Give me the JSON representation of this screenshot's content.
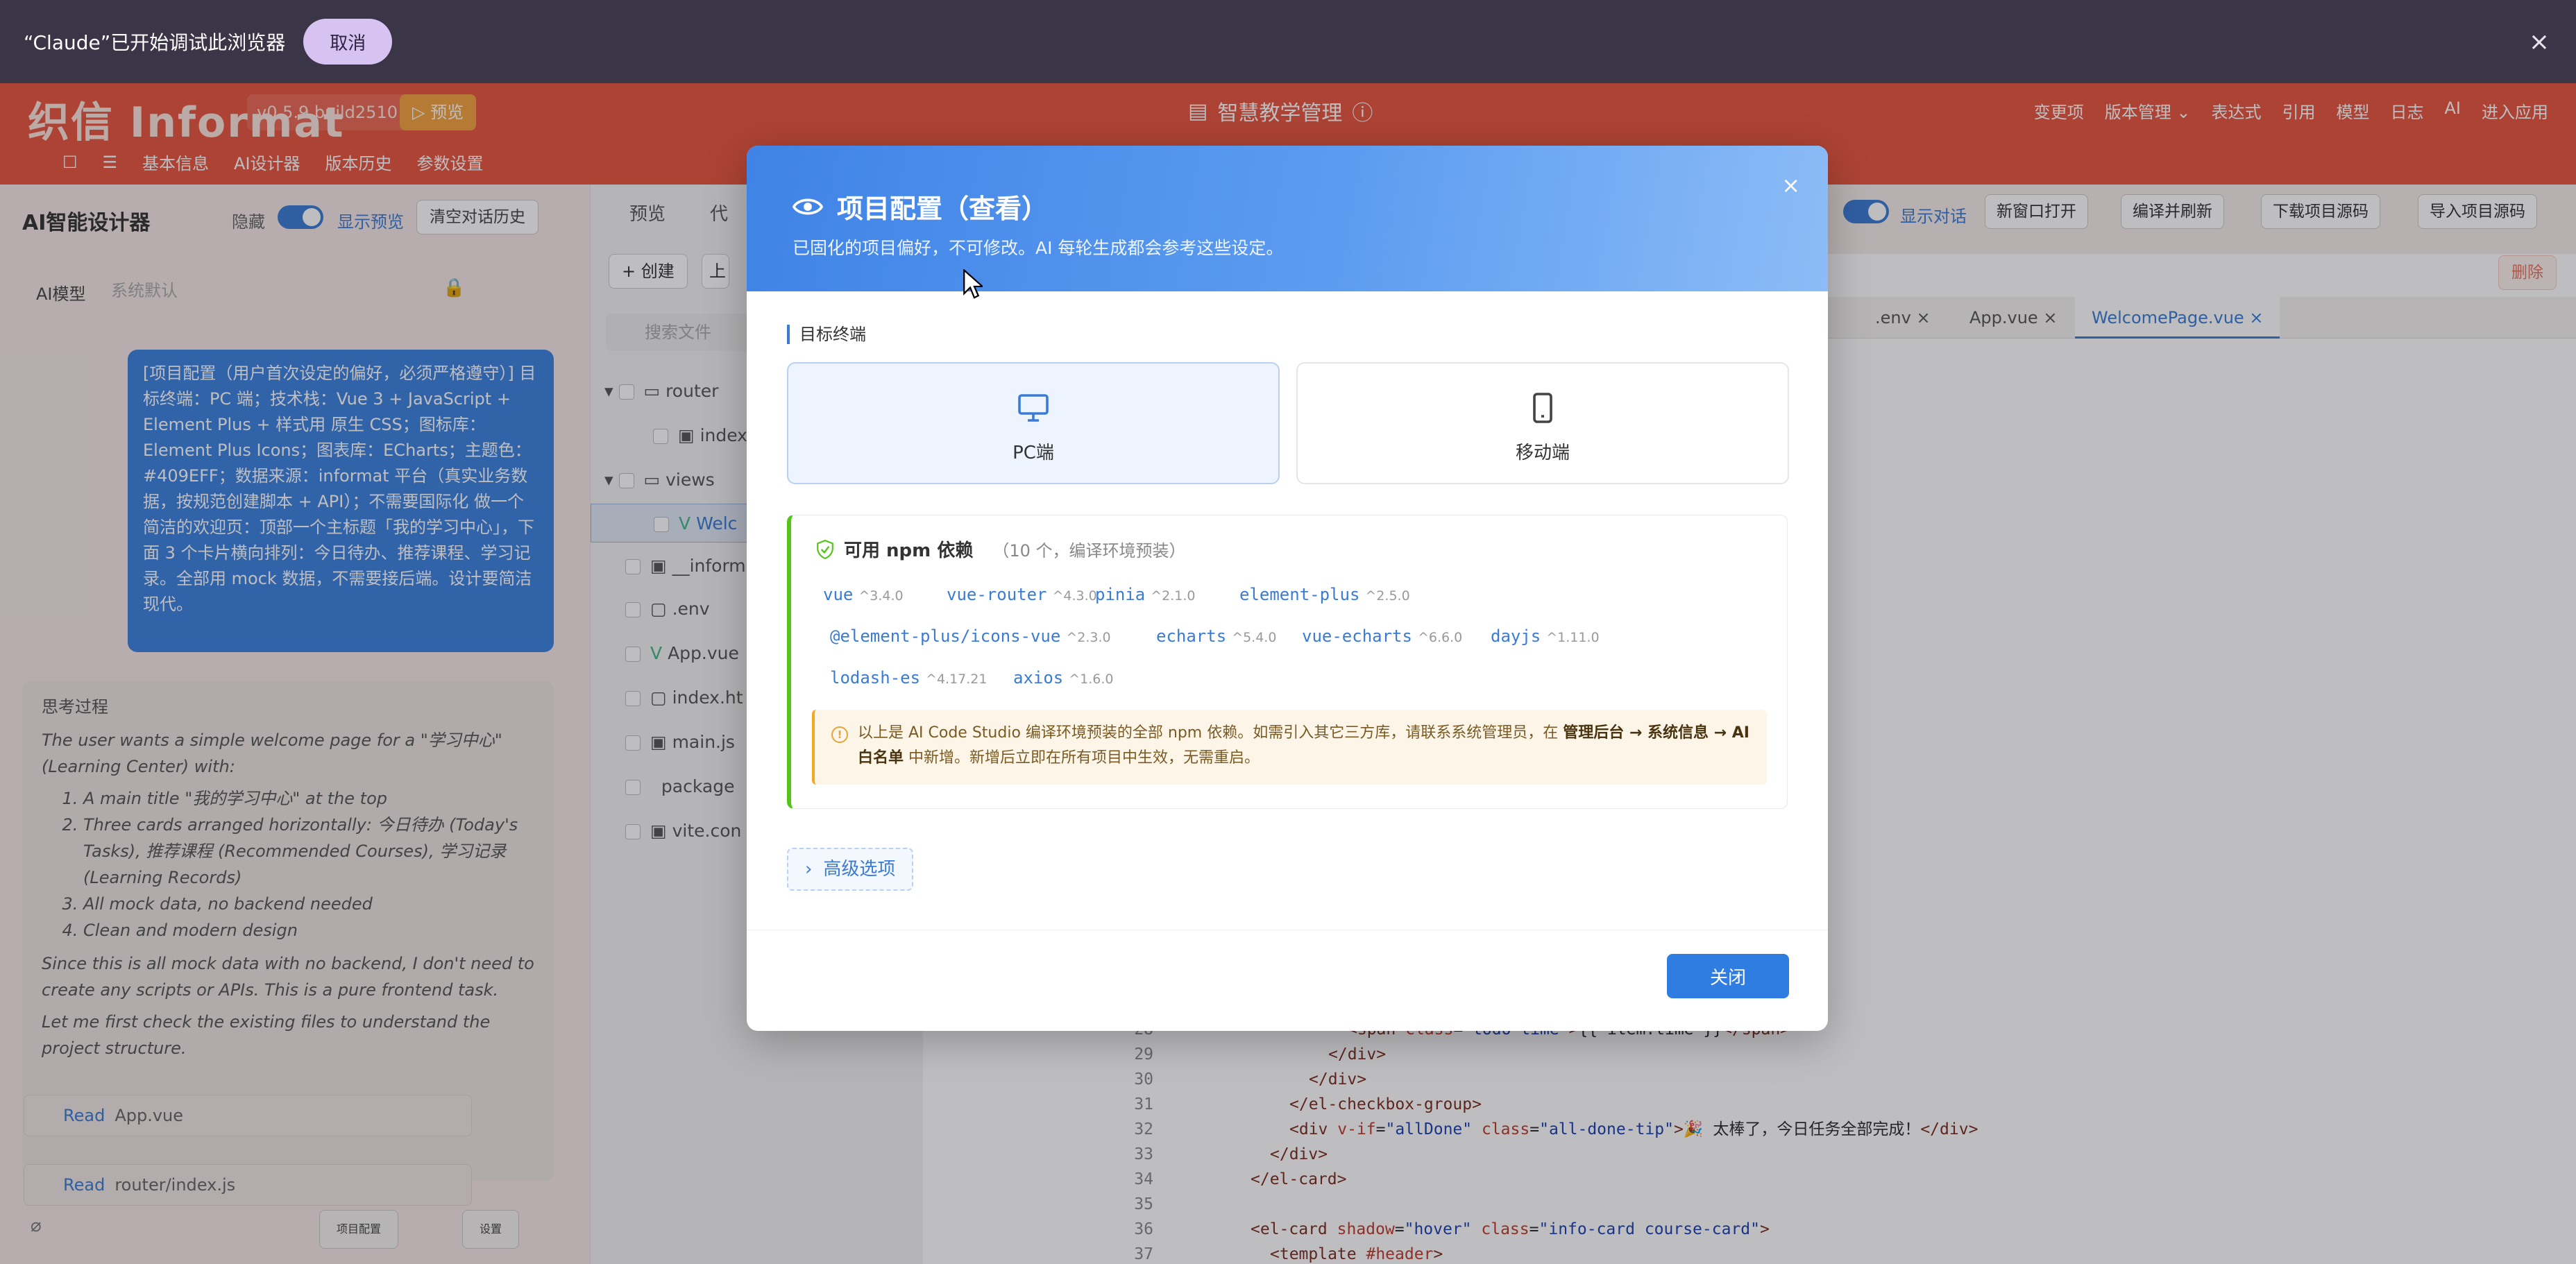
{
  "debug_bar": {
    "message": "“Claude”已开始调试此浏览器",
    "cancel": "取消",
    "close": "×"
  },
  "topbar": {
    "logo": "织信 Informat",
    "version": "v0.5.9 build2510",
    "preview": "▷ 预览",
    "app_title": "智慧教学管理",
    "actions": [
      "变更项",
      "版本管理 ⌄",
      "表达式",
      "引用",
      "模型",
      "日志",
      "AI",
      "进入应用"
    ],
    "subnav": [
      "基本信息",
      "AI设计器",
      "版本历史",
      "参数设置"
    ]
  },
  "left_panel": {
    "title": "AI智能设计器",
    "hide_label": "隐藏",
    "show_preview": "显示预览",
    "clear_history": "清空对话历史",
    "model_label": "AI模型",
    "model_value": "系统默认",
    "user_message": "[项目配置（用户首次设定的偏好，必须严格遵守）] 目标终端：PC 端；技术栈：Vue 3 + JavaScript + Element Plus + 样式用 原生 CSS；图标库：Element Plus Icons；图表库：ECharts；主题色：#409EFF；数据来源：informat 平台（真实业务数据，按规范创建脚本 + API）；不需要国际化 做一个简洁的欢迎页：顶部一个主标题「我的学习中心」，下面 3 个卡片横向排列：今日待办、推荐课程、学习记录。全部用 mock 数据，不需要接后端。设计要简洁现代。",
    "thinking_title": "思考过程",
    "thinking_intro": "The user wants a simple welcome page for a \"学习中心\" (Learning Center) with:",
    "thinking_items": [
      "A main title \"我的学习中心\" at the top",
      "Three cards arranged horizontally: 今日待办 (Today's Tasks), 推荐课程 (Recommended Courses), 学习记录 (Learning Records)",
      "All mock data, no backend needed",
      "Clean and modern design"
    ],
    "thinking_p2": "Since this is all mock data with no backend, I don't need to create any scripts or APIs. This is a pure frontend task.",
    "thinking_p3": "Let me first check the existing files to understand the project structure.",
    "reads": [
      {
        "verb": "Read",
        "file": "App.vue"
      },
      {
        "verb": "Read",
        "file": "router/index.js"
      }
    ],
    "project_config_btn": "项目配置",
    "settings_btn": "设置"
  },
  "file_panel": {
    "tabs": [
      "预览",
      "代"
    ],
    "create": "+ 创建",
    "upload": "上",
    "search_placeholder": "搜索文件",
    "tree": [
      {
        "label": "router",
        "kind": "folder"
      },
      {
        "label": "index",
        "kind": "file"
      },
      {
        "label": "views",
        "kind": "folder"
      },
      {
        "label": "Welc",
        "kind": "vue"
      },
      {
        "label": "__inform",
        "kind": "file"
      },
      {
        "label": ".env",
        "kind": "file"
      },
      {
        "label": "App.vue",
        "kind": "vue"
      },
      {
        "label": "index.ht",
        "kind": "file"
      },
      {
        "label": "main.js",
        "kind": "file"
      },
      {
        "label": "package",
        "kind": "file"
      },
      {
        "label": "vite.con",
        "kind": "file"
      }
    ]
  },
  "editor": {
    "show_chat": "显示对话",
    "buttons": [
      "新窗口打开",
      "编译并刷新",
      "下载项目源码",
      "导入项目源码"
    ],
    "delete": "删除",
    "tabs": [
      ".env ×",
      "App.vue ×",
      "WelcomePage.vue ×"
    ],
    "code_lines": [
      {
        "n": "28",
        "indent": 9,
        "html": "<span class=\"tag\">&lt;span</span> <span class=\"attr\">class</span>=<span class=\"str\">\"todo-time\"</span><span class=\"tag\">&gt;</span>{{ item.time }}<span class=\"tag\">&lt;/span&gt;</span>"
      },
      {
        "n": "29",
        "indent": 8,
        "html": "<span class=\"tag\">&lt;/div&gt;</span>"
      },
      {
        "n": "30",
        "indent": 7,
        "html": "<span class=\"tag\">&lt;/div&gt;</span>"
      },
      {
        "n": "31",
        "indent": 6,
        "html": "<span class=\"tag\">&lt;/el-checkbox-group&gt;</span>"
      },
      {
        "n": "32",
        "indent": 6,
        "html": "<span class=\"tag\">&lt;div</span> <span class=\"attr\">v-if</span>=<span class=\"str\">\"allDone\"</span> <span class=\"attr\">class</span>=<span class=\"str\">\"all-done-tip\"</span><span class=\"tag\">&gt;</span>🎉 太棒了，今日任务全部完成！<span class=\"tag\">&lt;/div&gt;</span>"
      },
      {
        "n": "33",
        "indent": 5,
        "html": "<span class=\"tag\">&lt;/div&gt;</span>"
      },
      {
        "n": "34",
        "indent": 4,
        "html": "<span class=\"tag\">&lt;/el-card&gt;</span>"
      },
      {
        "n": "35",
        "indent": 0,
        "html": ""
      },
      {
        "n": "36",
        "indent": 4,
        "html": "<span class=\"tag\">&lt;el-card</span> <span class=\"attr\">shadow</span>=<span class=\"str\">\"hover\"</span> <span class=\"attr\">class</span>=<span class=\"str\">\"info-card course-card\"</span><span class=\"tag\">&gt;</span>"
      },
      {
        "n": "37",
        "indent": 5,
        "html": "<span class=\"tag\">&lt;template</span> <span class=\"attr\">#header</span><span class=\"tag\">&gt;</span>"
      }
    ]
  },
  "modal": {
    "title": "项目配置（查看）",
    "subtitle": "已固化的项目偏好，不可修改。AI 每轮生成都会参考这些设定。",
    "close_x": "×",
    "section_target": "目标终端",
    "terminals": [
      {
        "label": "PC端",
        "selected": true
      },
      {
        "label": "移动端",
        "selected": false
      }
    ],
    "deps_title": "可用 npm 依赖",
    "deps_count": "（10 个，编译环境预装）",
    "deps": [
      {
        "name": "vue",
        "version": "^3.4.0"
      },
      {
        "name": "vue-router",
        "version": "^4.3.0"
      },
      {
        "name": "pinia",
        "version": "^2.1.0"
      },
      {
        "name": "element-plus",
        "version": "^2.5.0"
      },
      {
        "name": "@element-plus/icons-vue",
        "version": "^2.3.0"
      },
      {
        "name": "echarts",
        "version": "^5.4.0"
      },
      {
        "name": "vue-echarts",
        "version": "^6.6.0"
      },
      {
        "name": "dayjs",
        "version": "^1.11.0"
      },
      {
        "name": "lodash-es",
        "version": "^4.17.21"
      },
      {
        "name": "axios",
        "version": "^1.6.0"
      }
    ],
    "notice_pre": "以上是 AI Code Studio 编译环境预装的全部 npm 依赖。如需引入其它三方库，请联系系统管理员，在 ",
    "notice_bold": "管理后台 → 系统信息 → AI 白名单",
    "notice_post": " 中新增。新增后立即在所有项目中生效，无需重启。",
    "advanced": "高级选项",
    "close_button": "关闭"
  },
  "colors": {
    "primary": "#3a7bd5",
    "topbar": "#e8553d",
    "success": "#52c41a",
    "warning": "#f5a623"
  }
}
